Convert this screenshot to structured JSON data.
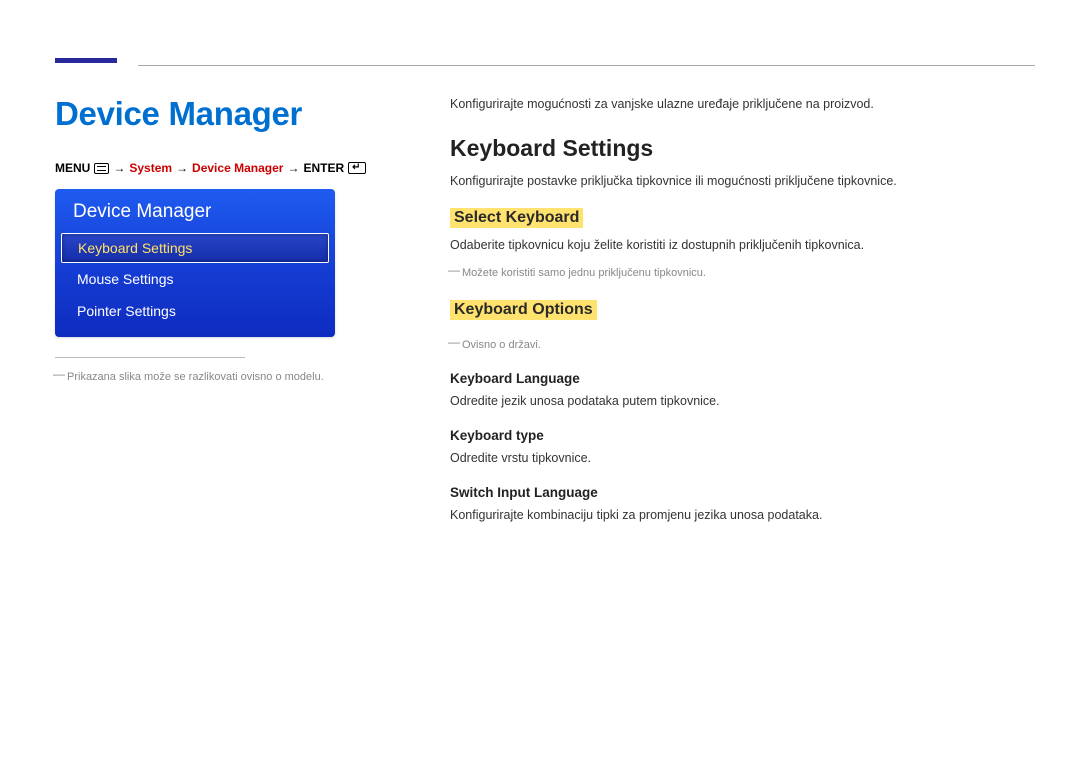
{
  "left": {
    "title": "Device Manager",
    "breadcrumb": {
      "menu": "MENU",
      "arrow": "→",
      "system": "System",
      "devmgr": "Device Manager",
      "enter": "ENTER"
    },
    "osd": {
      "title": "Device Manager",
      "items": [
        {
          "label": "Keyboard Settings",
          "selected": true
        },
        {
          "label": "Mouse Settings",
          "selected": false
        },
        {
          "label": "Pointer Settings",
          "selected": false
        }
      ]
    },
    "foot_model": "Prikazana slika može se razlikovati ovisno o modelu."
  },
  "right": {
    "intro": "Konfigurirajte mogućnosti za vanjske ulazne uređaje priključene na proizvod.",
    "h2": "Keyboard Settings",
    "h2_desc": "Konfigurirajte postavke priključka tipkovnice ili mogućnosti priključene tipkovnice.",
    "select_kb": {
      "title": "Select Keyboard",
      "desc": "Odaberite tipkovnicu koju želite koristiti iz dostupnih priključenih tipkovnica.",
      "note": "Možete koristiti samo jednu priključenu tipkovnicu."
    },
    "kb_options": {
      "title": "Keyboard Options",
      "note": "Ovisno o državi.",
      "lang": {
        "title": "Keyboard Language",
        "desc": "Odredite jezik unosa podataka putem tipkovnice."
      },
      "type": {
        "title": "Keyboard type",
        "desc": "Odredite vrstu tipkovnice."
      },
      "switch": {
        "title": "Switch Input Language",
        "desc": "Konfigurirajte kombinaciju tipki za promjenu jezika unosa podataka."
      }
    }
  }
}
